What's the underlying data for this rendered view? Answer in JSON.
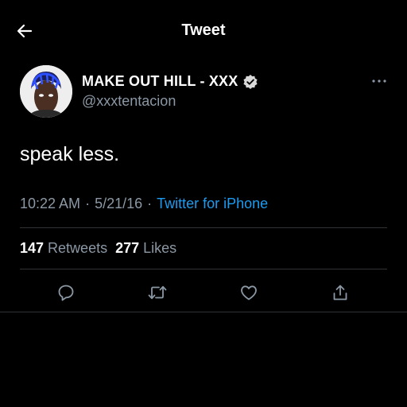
{
  "header": {
    "title": "Tweet",
    "back_icon": "arrow-left-icon"
  },
  "tweet": {
    "author": {
      "display_name": "MAKE OUT HILL - XXX",
      "handle": "@xxxtentacion",
      "verified": true
    },
    "text": "speak less.",
    "time": "10:22 AM",
    "date": "5/21/16",
    "separator": "·",
    "source": "Twitter for iPhone"
  },
  "stats": {
    "retweets_count": "147",
    "retweets_label": "Retweets",
    "likes_count": "277",
    "likes_label": "Likes"
  },
  "actions": [
    "reply-icon",
    "retweet-icon",
    "like-icon",
    "share-icon"
  ],
  "colors": {
    "background": "#000000",
    "text_primary": "#e7e9ea",
    "text_secondary": "#8b98a5",
    "accent": "#1d9bf0",
    "divider": "#2f3336"
  }
}
